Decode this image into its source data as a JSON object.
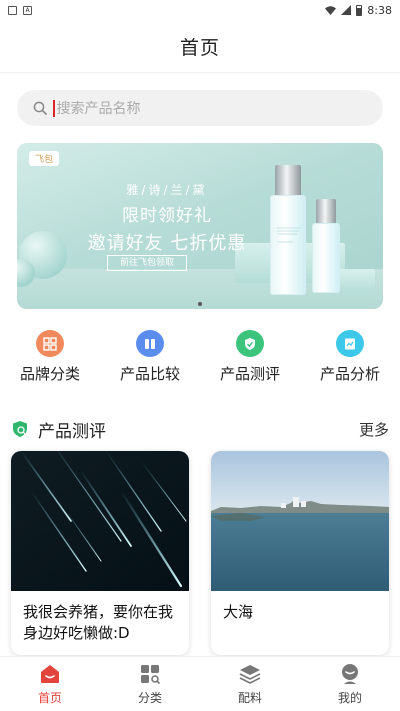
{
  "status_bar": {
    "time": "8:38",
    "left_icon_label": "A"
  },
  "header": {
    "title": "首页"
  },
  "search": {
    "placeholder": "搜索产品名称"
  },
  "banner": {
    "tag": "飞包",
    "brand": "雅/诗/兰/黛",
    "line1": "限时领好礼",
    "line2": "邀请好友  七折优惠",
    "button": "前往飞包领取"
  },
  "quick_links": [
    {
      "label": "品牌分类",
      "icon": "brand-category-icon",
      "color": "#f08a5d"
    },
    {
      "label": "产品比较",
      "icon": "product-compare-icon",
      "color": "#5b8def"
    },
    {
      "label": "产品测评",
      "icon": "product-review-icon",
      "color": "#3cc47c"
    },
    {
      "label": "产品分析",
      "icon": "product-analysis-icon",
      "color": "#3cc8e8"
    }
  ],
  "section": {
    "title": "产品测评",
    "more": "更多"
  },
  "cards": [
    {
      "title": "我很会养猪，要你在我身边好吃懒做:D"
    },
    {
      "title": "大海"
    }
  ],
  "tabbar": {
    "items": [
      {
        "label": "首页",
        "icon": "home-icon",
        "active": true
      },
      {
        "label": "分类",
        "icon": "category-icon",
        "active": false
      },
      {
        "label": "配料",
        "icon": "ingredients-icon",
        "active": false
      },
      {
        "label": "我的",
        "icon": "profile-icon",
        "active": false
      }
    ]
  },
  "colors": {
    "accent": "#e3443c",
    "caret": "#e0222f"
  }
}
